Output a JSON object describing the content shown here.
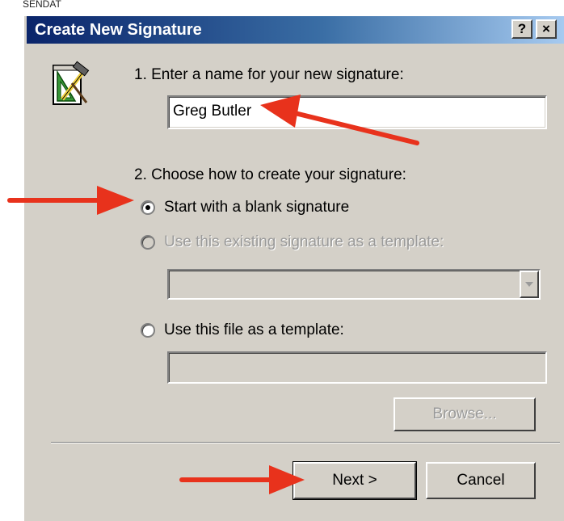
{
  "background": {
    "partial_text": "SENDAT"
  },
  "dialog": {
    "title": "Create New Signature",
    "help_button": "?",
    "close_button": "×",
    "step1_label": "1. Enter a name for your new signature:",
    "name_value": "Greg Butler",
    "step2_label": "2. Choose how to create your signature:",
    "options": {
      "blank": "Start with a blank signature",
      "existing": "Use this existing signature as a template:",
      "file": "Use this file as a template:"
    },
    "existing_selected": "",
    "file_path": "",
    "browse_label": "Browse...",
    "next_label": "Next >",
    "cancel_label": "Cancel"
  },
  "colors": {
    "title_start": "#0a246a",
    "title_end": "#a6caf0",
    "dialog_face": "#d4d0c8",
    "annotation_arrow": "#e8321c"
  },
  "icons": {
    "signature": "pencil-ruler-hammer-icon",
    "combo_arrow": "triangle-down-icon",
    "arrow": "annotation-arrow-icon"
  }
}
